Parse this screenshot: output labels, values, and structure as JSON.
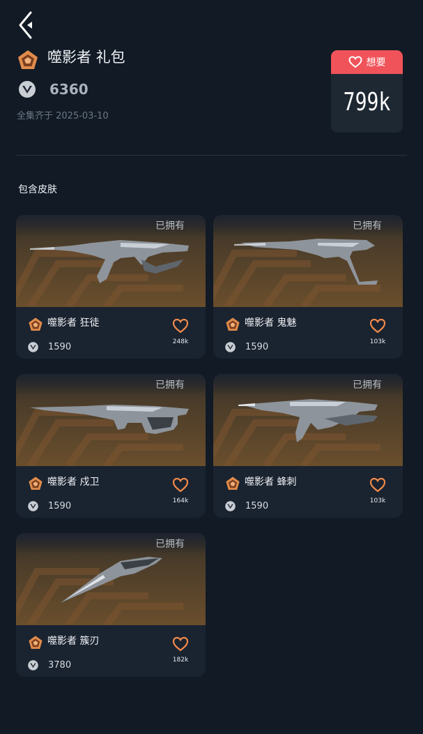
{
  "bundle": {
    "title": "噬影者 礼包",
    "price": "6360",
    "date": "全集齐于 2025-03-10"
  },
  "want": {
    "label": "想要",
    "count": "799k"
  },
  "section": {
    "label": "包含皮肤"
  },
  "skins": [
    {
      "name": "噬影者 狂徒",
      "price": "1590",
      "owned": "已拥有",
      "wants": "248k"
    },
    {
      "name": "噬影者 鬼魅",
      "price": "1590",
      "owned": "已拥有",
      "wants": "103k"
    },
    {
      "name": "噬影者 戍卫",
      "price": "1590",
      "owned": "已拥有",
      "wants": "164k"
    },
    {
      "name": "噬影者 蜂刺",
      "price": "1590",
      "owned": "已拥有",
      "wants": "103k"
    },
    {
      "name": "噬影者 簇刃",
      "price": "3780",
      "owned": "已拥有",
      "wants": "182k"
    }
  ],
  "colors": {
    "background": "#111a25",
    "accent": "#f0535a",
    "tier": "#e08c4c",
    "heart": "#f08a4b"
  }
}
